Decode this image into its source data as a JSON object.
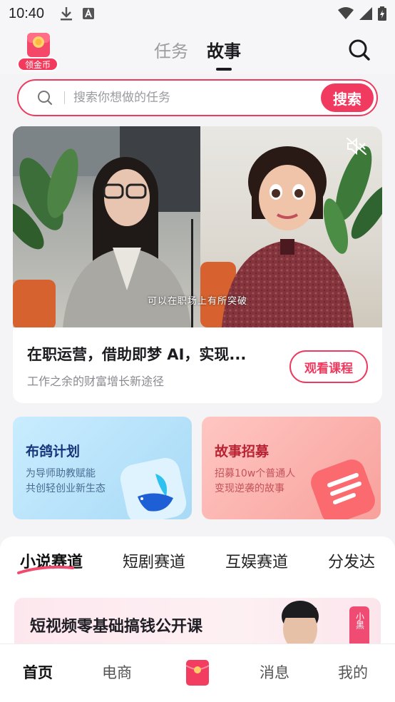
{
  "status_bar": {
    "time": "10:40"
  },
  "header": {
    "coin_label": "领金币",
    "tabs": [
      {
        "label": "任务",
        "active": false
      },
      {
        "label": "故事",
        "active": true
      }
    ]
  },
  "search": {
    "placeholder": "搜索你想做的任务",
    "button_label": "搜索"
  },
  "video_card": {
    "subtitle": "可以在职场上有所突破",
    "title": "在职运营，借助即梦 AI，实现...",
    "description": "工作之余的财富增长新途径",
    "button_label": "观看课程"
  },
  "promos": [
    {
      "title": "布鸽计划",
      "desc_line1": "为导师助教赋能",
      "desc_line2": "共创轻创业新生态",
      "accent": "#17357a"
    },
    {
      "title": "故事招募",
      "desc_line1": "招募10w个普通人",
      "desc_line2": "变现逆袭的故事",
      "accent": "#b82334"
    }
  ],
  "category_tabs": [
    {
      "label": "小说赛道",
      "active": true
    },
    {
      "label": "短剧赛道",
      "active": false
    },
    {
      "label": "互娱赛道",
      "active": false
    },
    {
      "label": "分发达",
      "active": false
    }
  ],
  "banner": {
    "title": "短视频零基础搞钱公开课",
    "tag": "小黑"
  },
  "bottom_nav": [
    {
      "label": "首页",
      "active": true
    },
    {
      "label": "电商",
      "active": false
    },
    {
      "label": "消息",
      "active": false
    },
    {
      "label": "我的",
      "active": false
    }
  ],
  "colors": {
    "accent": "#ee3a5e",
    "text_primary": "#1c1c20",
    "text_secondary": "#8a8a90"
  }
}
